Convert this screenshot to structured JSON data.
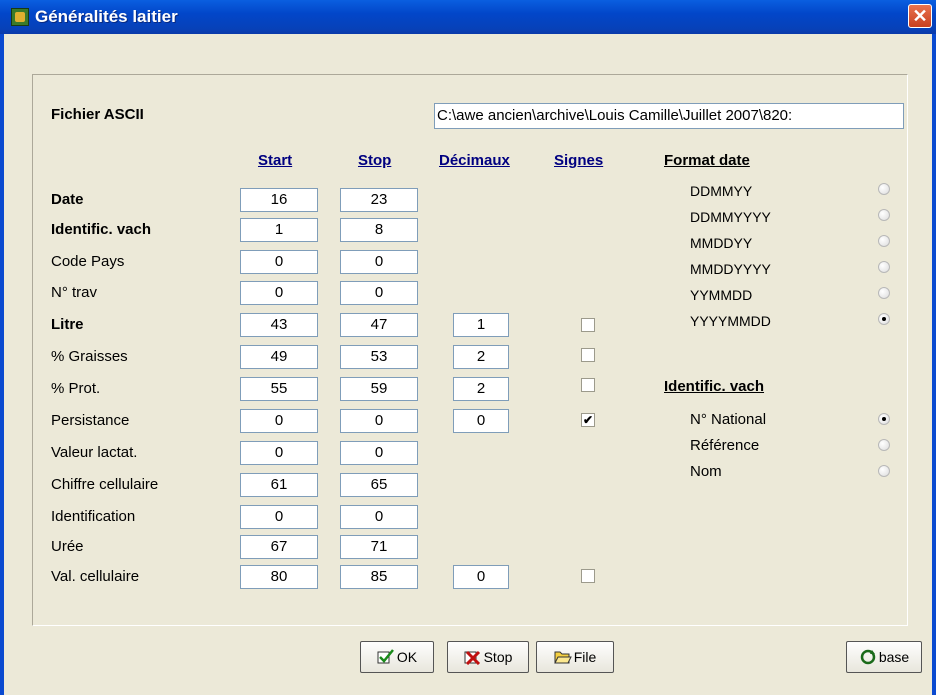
{
  "window": {
    "title": "Généralités laitier",
    "close_glyph": "✕"
  },
  "file": {
    "label": "Fichier ASCII",
    "path": "C:\\awe ancien\\archive\\Louis Camille\\Juillet 2007\\820:"
  },
  "columns": {
    "start": "Start",
    "stop": "Stop",
    "decimals": "Décimaux",
    "signs": "Signes"
  },
  "fields": [
    {
      "label": "Date",
      "bold": true,
      "start": "16",
      "stop": "23"
    },
    {
      "label": "Identific. vach",
      "bold": true,
      "start": "1",
      "stop": "8"
    },
    {
      "label": "Code Pays",
      "bold": false,
      "start": "0",
      "stop": "0"
    },
    {
      "label": "N° trav",
      "bold": false,
      "start": "0",
      "stop": "0"
    },
    {
      "label": "Litre",
      "bold": true,
      "start": "43",
      "stop": "47",
      "decimals": "1",
      "signed": false
    },
    {
      "label": "% Graisses",
      "bold": false,
      "start": "49",
      "stop": "53",
      "decimals": "2",
      "signed": false
    },
    {
      "label": "% Prot.",
      "bold": false,
      "start": "55",
      "stop": "59",
      "decimals": "2",
      "signed": false
    },
    {
      "label": "Persistance",
      "bold": false,
      "start": "0",
      "stop": "0",
      "decimals": "0",
      "signed": true
    },
    {
      "label": "Valeur lactat.",
      "bold": false,
      "start": "0",
      "stop": "0"
    },
    {
      "label": "Chiffre cellulaire",
      "bold": false,
      "start": "61",
      "stop": "65"
    },
    {
      "label": "Identification",
      "bold": false,
      "start": "0",
      "stop": "0"
    },
    {
      "label": "Urée",
      "bold": false,
      "start": "67",
      "stop": "71"
    },
    {
      "label": "Val. cellulaire",
      "bold": false,
      "start": "80",
      "stop": "85",
      "decimals": "0",
      "signed": false
    }
  ],
  "date_format": {
    "title": "Format date",
    "options": [
      "DDMMYY",
      "DDMMYYYY",
      "MMDDYY",
      "MMDDYYYY",
      "YYMMDD",
      "YYYYMMDD"
    ],
    "selected": "YYYYMMDD"
  },
  "cow_id": {
    "title": "Identific. vach",
    "options": [
      "N° National",
      "Référence",
      "Nom"
    ],
    "selected": "N° National"
  },
  "buttons": {
    "ok": "OK",
    "stop": "Stop",
    "file": "File",
    "base": "base"
  },
  "colors": {
    "title_bar": "#0a5fe0",
    "link_header": "#000080",
    "background": "#ece9d8"
  },
  "icons": {
    "app": "cow-app-icon",
    "ok": "check-icon",
    "stop": "cross-icon",
    "file": "folder-open-icon",
    "base": "refresh-icon"
  }
}
